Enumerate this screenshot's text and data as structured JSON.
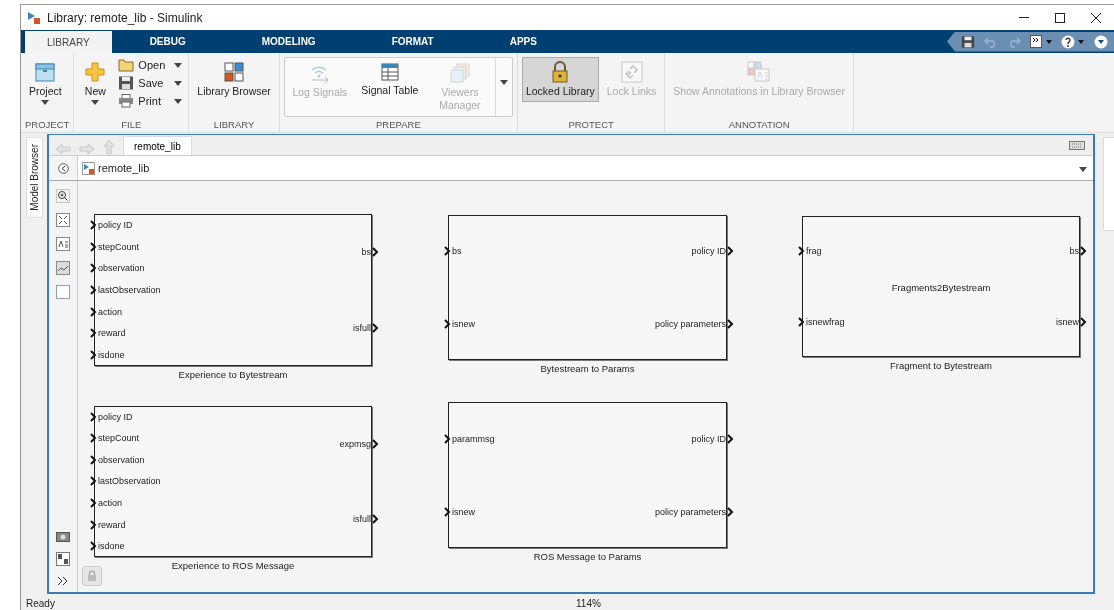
{
  "window": {
    "title": "Library: remote_lib - Simulink"
  },
  "ribbon_tabs": [
    {
      "label": "LIBRARY",
      "selected": true
    },
    {
      "label": "DEBUG",
      "selected": false
    },
    {
      "label": "MODELING",
      "selected": false
    },
    {
      "label": "FORMAT",
      "selected": false
    },
    {
      "label": "APPS",
      "selected": false
    }
  ],
  "ribbon_groups": [
    {
      "label": "PROJECT",
      "items": [
        {
          "kind": "big",
          "label": "Project",
          "dropdown": true,
          "disabled": false,
          "pressed": false
        }
      ]
    },
    {
      "label": "FILE",
      "items": [
        {
          "kind": "big",
          "label": "New",
          "dropdown": true,
          "disabled": false,
          "pressed": false
        },
        {
          "kind": "stack",
          "entries": [
            {
              "label": "Open"
            },
            {
              "label": "Save"
            },
            {
              "label": "Print"
            }
          ]
        }
      ]
    },
    {
      "label": "LIBRARY",
      "items": [
        {
          "kind": "big",
          "label": "Library Browser",
          "dropdown": false,
          "disabled": false,
          "pressed": false
        }
      ]
    },
    {
      "label": "PREPARE",
      "items": [
        {
          "kind": "gallery",
          "entries": [
            {
              "label": "Log Signals",
              "disabled": true
            },
            {
              "label": "Signal Table",
              "disabled": false
            },
            {
              "label": "Viewers Manager",
              "disabled": true
            }
          ]
        }
      ]
    },
    {
      "label": "PROTECT",
      "items": [
        {
          "kind": "big",
          "label": "Locked Library",
          "dropdown": false,
          "disabled": false,
          "pressed": true
        },
        {
          "kind": "big",
          "label": "Lock Links",
          "dropdown": false,
          "disabled": true,
          "pressed": false
        }
      ]
    },
    {
      "label": "ANNOTATION",
      "items": [
        {
          "kind": "big",
          "label": "Show Annotations in Library Browser",
          "dropdown": false,
          "disabled": true,
          "pressed": false
        }
      ]
    }
  ],
  "side_tabs": {
    "left": "Model Browser"
  },
  "editor_tabs": [
    {
      "label": "remote_lib",
      "selected": true
    }
  ],
  "breadcrumb": {
    "path": "remote_lib"
  },
  "blocks": [
    {
      "name": "Experience to Bytestream",
      "inputs": [
        "policy ID",
        "stepCount",
        "observation",
        "lastObservation",
        "action",
        "reward",
        "isdone"
      ],
      "outputs": [
        "bs",
        "isfull"
      ]
    },
    {
      "name": "Bytestream to Params",
      "inputs": [
        "bs",
        "isnew"
      ],
      "outputs": [
        "policy ID",
        "policy parameters"
      ]
    },
    {
      "name": "Fragment to Bytestream",
      "display_text": "Fragments2Bytestream",
      "inputs": [
        "frag",
        "isnewfrag"
      ],
      "outputs": [
        "bs",
        "isnew"
      ]
    },
    {
      "name": "Experience to ROS Message",
      "inputs": [
        "policy ID",
        "stepCount",
        "observation",
        "lastObservation",
        "action",
        "reward",
        "isdone"
      ],
      "outputs": [
        "expmsg",
        "isfull"
      ]
    },
    {
      "name": "ROS Message to Params",
      "inputs": [
        "parammsg",
        "isnew"
      ],
      "outputs": [
        "policy ID",
        "policy parameters"
      ]
    }
  ],
  "status_bar": {
    "state": "Ready",
    "zoom": "114%"
  }
}
